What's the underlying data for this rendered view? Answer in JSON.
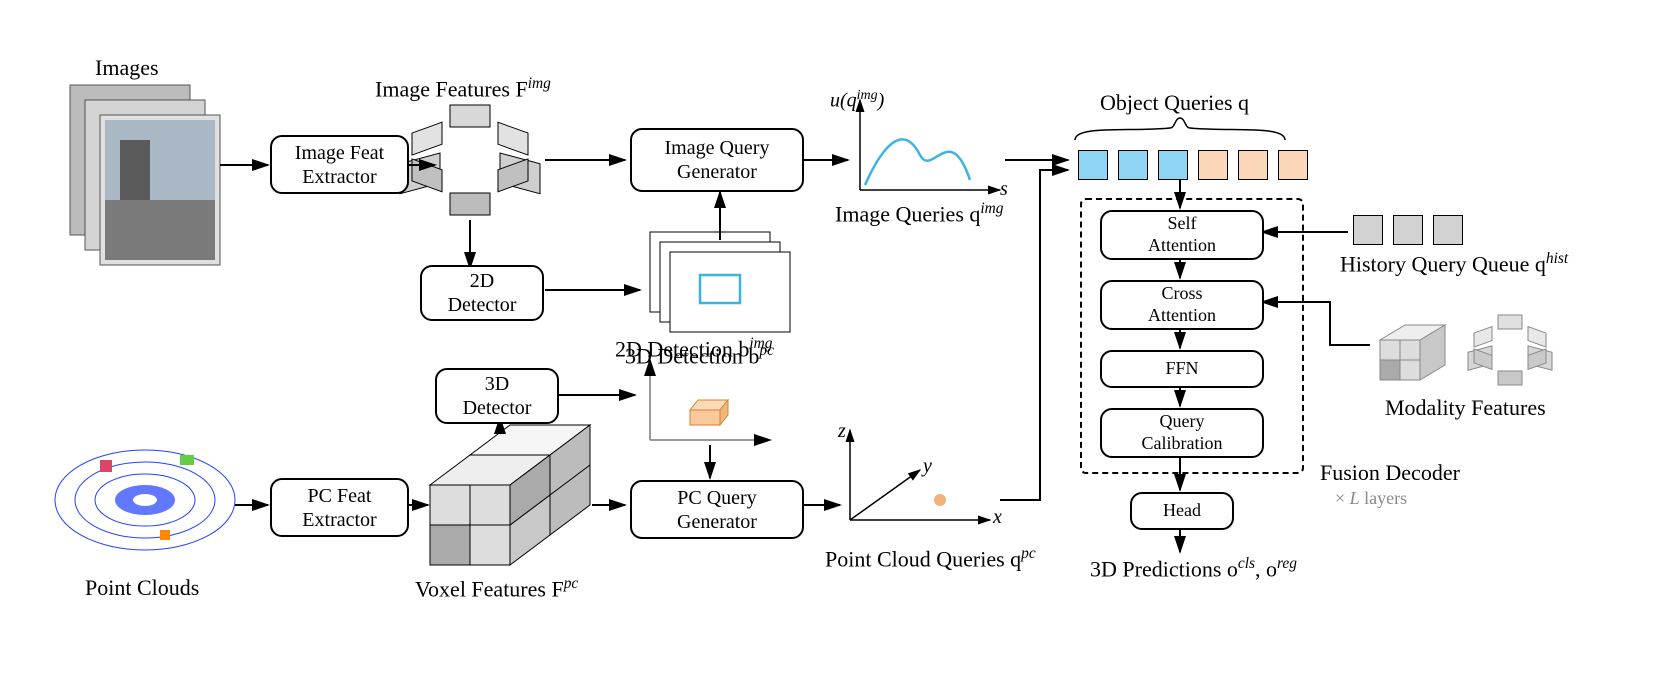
{
  "labels": {
    "images": "Images",
    "pointClouds": "Point Clouds",
    "imageFeat": "Image Features F",
    "imageFeatSup": "img",
    "voxelFeat": "Voxel Features F",
    "voxelFeatSup": "pc",
    "det2d": "2D Detection b",
    "det2dSup": "img",
    "det3d": "3D Detection b",
    "det3dSup": "pc",
    "imgQueries": "Image Queries q",
    "imgQueriesSup": "img",
    "pcQueries": "Point Cloud Queries q",
    "pcQueriesSup": "pc",
    "uq": "u(q",
    "uqSup": "img",
    "uqClose": ")",
    "sVar": "s",
    "xVar": "x",
    "yVar": "y",
    "zVar": "z",
    "objectQueries": "Object Queries q",
    "historyQueue": "History Query Queue q",
    "historyQueueSup": "hist",
    "modalityFeatures": "Modality Features",
    "fusionDecoder": "Fusion Decoder",
    "layers": "× L layers",
    "predictions": "3D Predictions o",
    "predSup1": "cls",
    "predSep": ", o",
    "predSup2": "reg"
  },
  "blocks": {
    "imgFeatExtractor": "Image Feat\nExtractor",
    "pcFeatExtractor": "PC Feat\nExtractor",
    "imgQGen": "Image Query\nGenerator",
    "pcQGen": "PC Query\nGenerator",
    "det2d": "2D\nDetector",
    "det3d": "3D\nDetector",
    "selfAtt": "Self\nAttention",
    "crossAtt": "Cross\nAttention",
    "ffn": "FFN",
    "queryCalib": "Query\nCalibration",
    "head": "Head"
  }
}
